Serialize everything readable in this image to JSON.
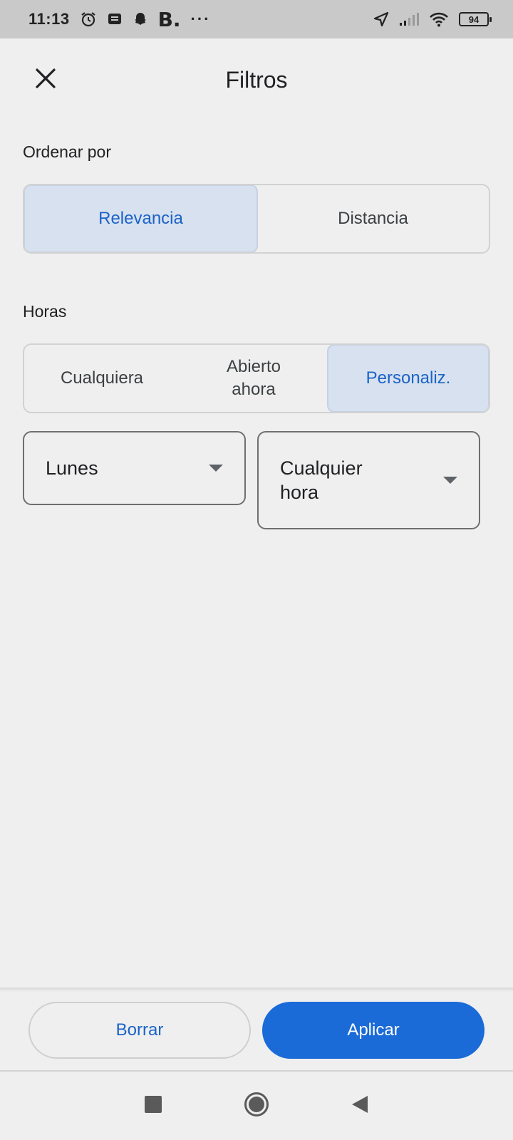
{
  "status_bar": {
    "time": "11:13",
    "b_label": "B.",
    "dots": "···",
    "battery": "94"
  },
  "header": {
    "title": "Filtros"
  },
  "sort": {
    "label": "Ordenar por",
    "options": [
      "Relevancia",
      "Distancia"
    ],
    "selected": "Relevancia"
  },
  "hours": {
    "label": "Horas",
    "options": [
      "Cualquiera",
      "Abierto ahora",
      "Personaliz."
    ],
    "selected": "Personaliz.",
    "day_dropdown": "Lunes",
    "time_dropdown": "Cualquier hora"
  },
  "actions": {
    "clear_label": "Borrar",
    "apply_label": "Aplicar"
  },
  "colors": {
    "accent": "#1a63c7",
    "apply_bg": "#1a6ad8",
    "selected_bg": "#d8e1ef",
    "background": "#efefef"
  },
  "icons": {
    "close": "close-icon",
    "dropdown": "caret-down-icon",
    "nav_recent": "square-icon",
    "nav_home": "circle-icon",
    "nav_back": "back-triangle-icon"
  }
}
